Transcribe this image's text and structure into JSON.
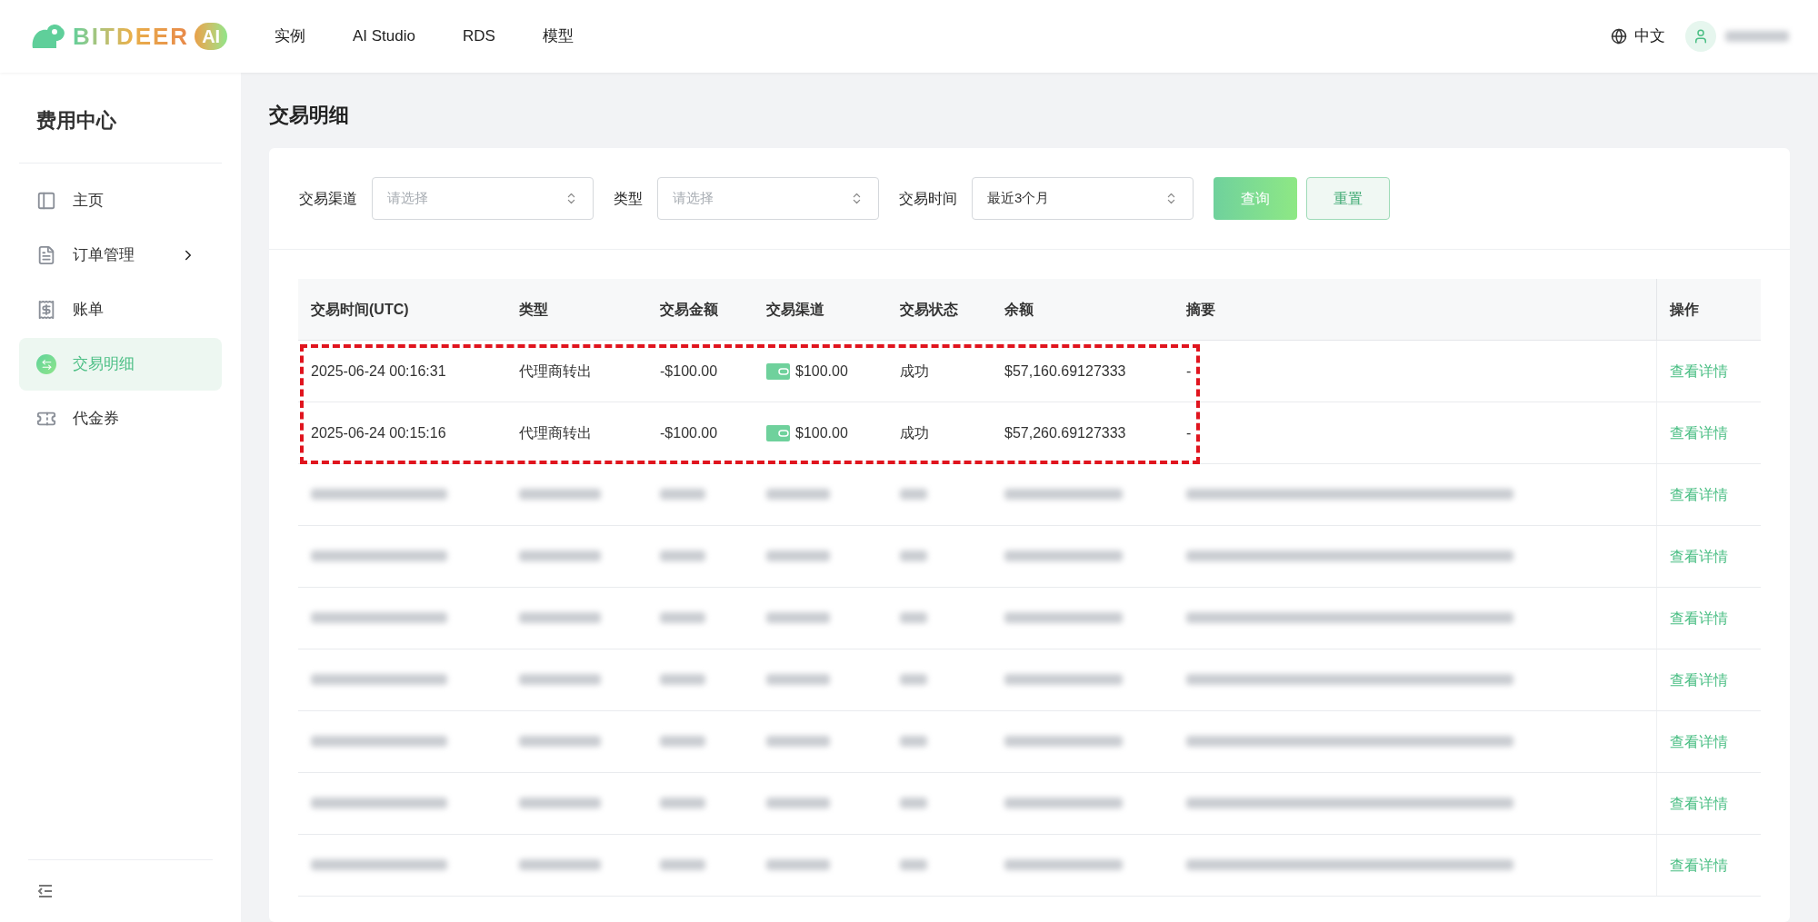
{
  "header": {
    "logo": {
      "wordmark": "BITDEER",
      "badge": "AI"
    },
    "nav": [
      {
        "label": "实例"
      },
      {
        "label": "AI Studio"
      },
      {
        "label": "RDS"
      },
      {
        "label": "模型"
      }
    ],
    "language": "中文"
  },
  "sidebar": {
    "title": "费用中心",
    "items": [
      {
        "label": "主页",
        "selected": false,
        "has_submenu": false
      },
      {
        "label": "订单管理",
        "selected": false,
        "has_submenu": true
      },
      {
        "label": "账单",
        "selected": false,
        "has_submenu": false
      },
      {
        "label": "交易明细",
        "selected": true,
        "has_submenu": false
      },
      {
        "label": "代金券",
        "selected": false,
        "has_submenu": false
      }
    ]
  },
  "page": {
    "title": "交易明细"
  },
  "filters": {
    "fields": [
      {
        "label": "交易渠道",
        "placeholder": "请选择"
      },
      {
        "label": "类型",
        "placeholder": "请选择"
      },
      {
        "label": "交易时间",
        "value": "最近3个月"
      }
    ],
    "buttons": [
      {
        "label": "查询",
        "kind": "primary"
      },
      {
        "label": "重置",
        "kind": "secondary"
      }
    ]
  },
  "table": {
    "columns": [
      "交易时间(UTC)",
      "类型",
      "交易金额",
      "交易渠道",
      "交易状态",
      "余额",
      "摘要",
      "操作"
    ],
    "rows": [
      {
        "blurred": false,
        "highlighted": true,
        "time": "2025-06-24 00:16:31",
        "type": "代理商转出",
        "amount": "-$100.00",
        "channel": "$100.00",
        "status": "成功",
        "balance": "$57,160.69127333",
        "summary": "-",
        "action": "查看详情"
      },
      {
        "blurred": false,
        "highlighted": true,
        "time": "2025-06-24 00:15:16",
        "type": "代理商转出",
        "amount": "-$100.00",
        "channel": "$100.00",
        "status": "成功",
        "balance": "$57,260.69127333",
        "summary": "-",
        "action": "查看详情"
      },
      {
        "blurred": true,
        "highlighted": false,
        "action": "查看详情"
      },
      {
        "blurred": true,
        "highlighted": false,
        "action": "查看详情"
      },
      {
        "blurred": true,
        "highlighted": false,
        "action": "查看详情"
      },
      {
        "blurred": true,
        "highlighted": false,
        "action": "查看详情"
      },
      {
        "blurred": true,
        "highlighted": false,
        "action": "查看详情"
      },
      {
        "blurred": true,
        "highlighted": false,
        "action": "查看详情"
      },
      {
        "blurred": true,
        "highlighted": false,
        "action": "查看详情"
      }
    ]
  }
}
